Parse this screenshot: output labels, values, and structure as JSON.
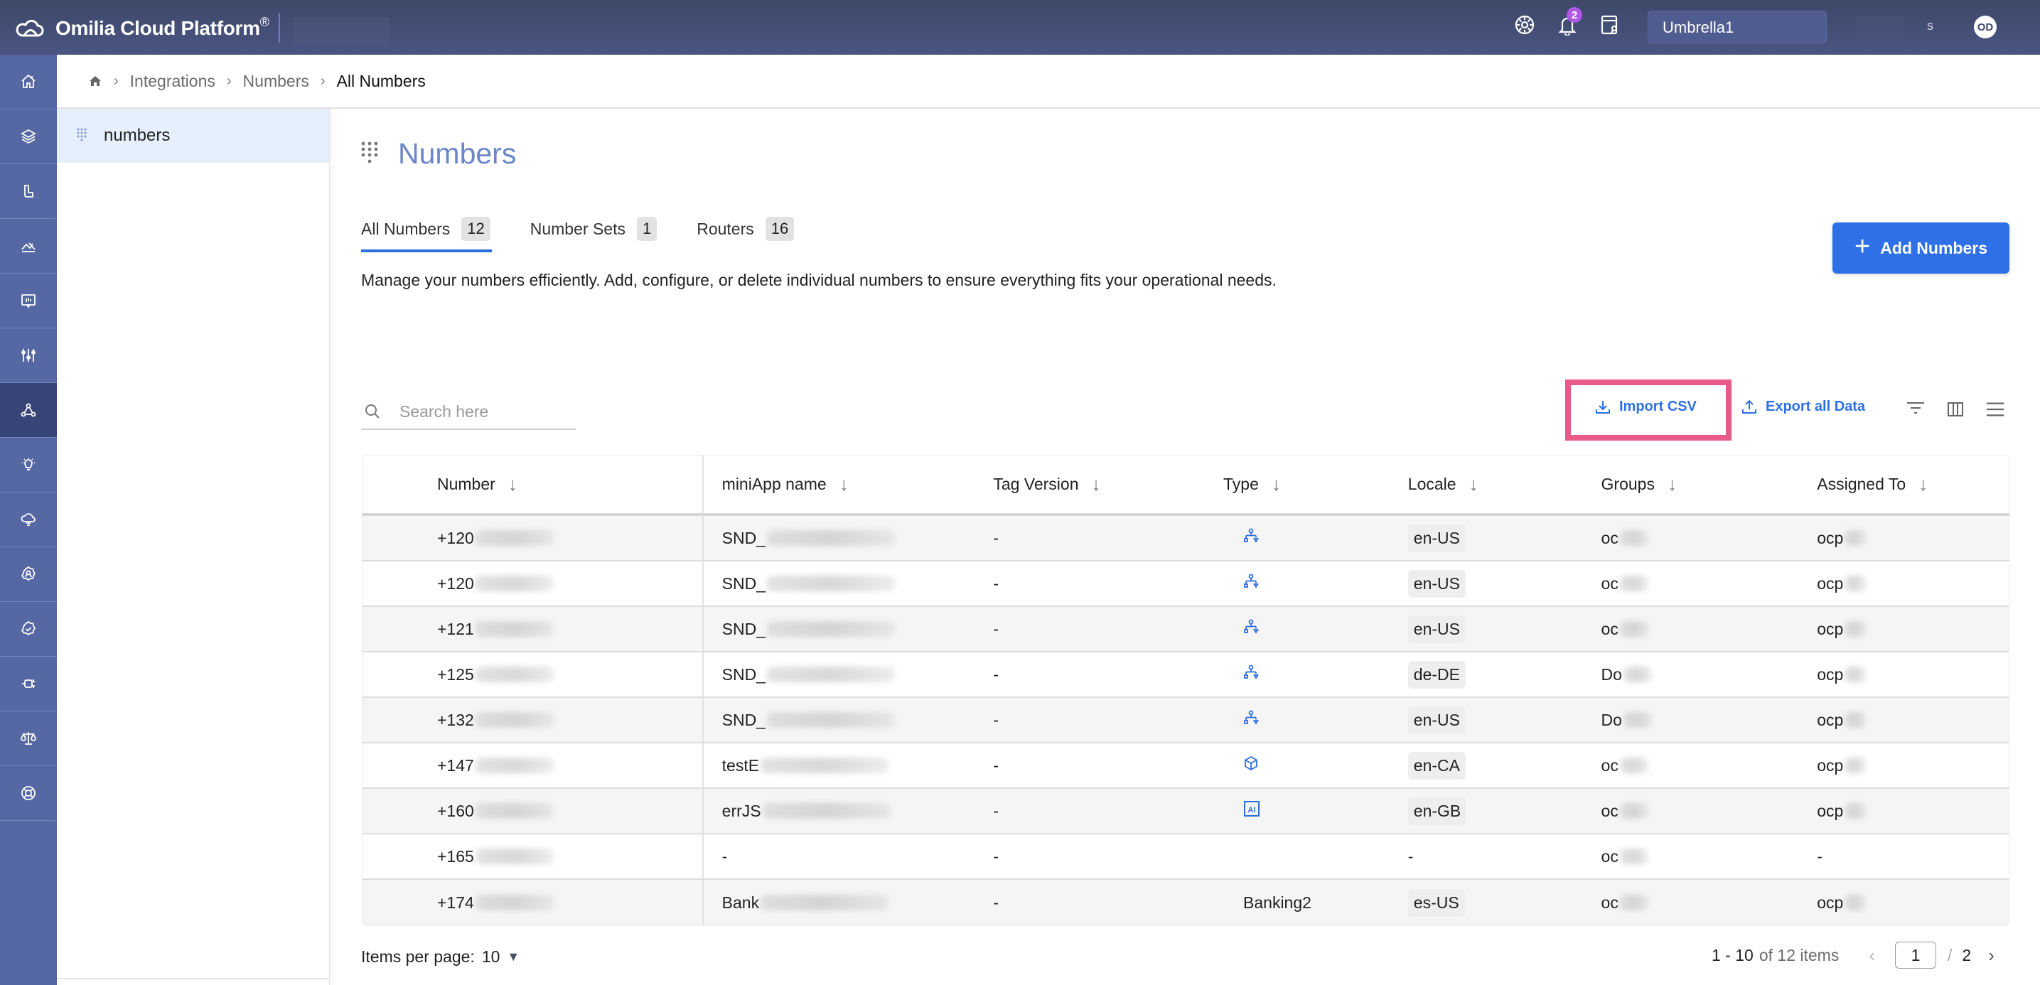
{
  "app": {
    "title": "Omilia Cloud Platform",
    "trademark": "®",
    "notification_count": "2",
    "tenant": "Umbrella1",
    "user_initials": "OD",
    "user_blur_fragment": "s"
  },
  "colors": {
    "header": "#434e74",
    "rail": "#5568a4",
    "rail_active": "#384677",
    "accent": "#2d70e7",
    "title": "#6b86c9",
    "highlight_box": "#e85a87",
    "badge": "#b158e6"
  },
  "rail": {
    "items": [
      {
        "icon": "home-icon"
      },
      {
        "icon": "layers-icon"
      },
      {
        "icon": "bot-icon"
      },
      {
        "icon": "analytics-icon"
      },
      {
        "icon": "monitor-icon"
      },
      {
        "icon": "sliders-icon"
      },
      {
        "icon": "integrations-icon",
        "active": true
      },
      {
        "icon": "lightbulb-icon"
      },
      {
        "icon": "cloud-icon"
      },
      {
        "icon": "user-settings-icon"
      },
      {
        "icon": "verified-badge-icon"
      },
      {
        "icon": "connector-icon"
      },
      {
        "icon": "scale-icon"
      },
      {
        "icon": "lifebuoy-icon"
      }
    ]
  },
  "breadcrumb": {
    "items": [
      "Integrations",
      "Numbers"
    ],
    "current": "All Numbers"
  },
  "subnav": {
    "items": [
      {
        "label": "numbers",
        "active": true
      }
    ]
  },
  "page": {
    "title": "Numbers",
    "description": "Manage your numbers efficiently. Add, configure, or delete individual numbers to ensure everything fits your operational needs.",
    "add_button": "Add Numbers"
  },
  "tabs": [
    {
      "label": "All Numbers",
      "count": "12",
      "active": true
    },
    {
      "label": "Number Sets",
      "count": "1"
    },
    {
      "label": "Routers",
      "count": "16"
    }
  ],
  "toolbar": {
    "search_placeholder": "Search here",
    "import_label": "Import CSV",
    "export_label": "Export all Data"
  },
  "table": {
    "columns": [
      "Number",
      "miniApp name",
      "Tag Version",
      "Type",
      "Locale",
      "Groups",
      "Assigned To"
    ],
    "rows": [
      {
        "number": "+120",
        "app": "SND_",
        "tag": "-",
        "type": "router",
        "type_label": "",
        "locale": "en-US",
        "groups": "oc",
        "assigned": "ocp"
      },
      {
        "number": "+120",
        "app": "SND_",
        "tag": "-",
        "type": "router",
        "type_label": "",
        "locale": "en-US",
        "groups": "oc",
        "assigned": "ocp"
      },
      {
        "number": "+121",
        "app": "SND_",
        "tag": "-",
        "type": "router",
        "type_label": "",
        "locale": "en-US",
        "groups": "oc",
        "assigned": "ocp"
      },
      {
        "number": "+125",
        "app": "SND_",
        "tag": "-",
        "type": "router",
        "type_label": "",
        "locale": "de-DE",
        "groups": "Do",
        "assigned": "ocp"
      },
      {
        "number": "+132",
        "app": "SND_",
        "tag": "-",
        "type": "router",
        "type_label": "",
        "locale": "en-US",
        "groups": "Do",
        "assigned": "ocp"
      },
      {
        "number": "+147",
        "app": "testE",
        "tag": "-",
        "type": "cube",
        "type_label": "",
        "locale": "en-CA",
        "groups": "oc",
        "assigned": "ocp"
      },
      {
        "number": "+160",
        "app": "errJS",
        "tag": "-",
        "type": "ai",
        "type_label": "",
        "locale": "en-GB",
        "groups": "oc",
        "assigned": "ocp"
      },
      {
        "number": "+165",
        "app": "-",
        "tag": "-",
        "type": "none",
        "type_label": "",
        "locale": "-",
        "groups": "oc",
        "assigned": "-"
      },
      {
        "number": "+174",
        "app": "Bank",
        "tag": "-",
        "type": "text",
        "type_label": "Banking2",
        "locale": "es-US",
        "groups": "oc",
        "assigned": "ocp"
      }
    ]
  },
  "pagination": {
    "items_per_page_label": "Items per page:",
    "items_per_page": "10",
    "range": "1 - 10",
    "of_text": "of 12 items",
    "current_page": "1",
    "separator": "/",
    "total_pages": "2"
  }
}
